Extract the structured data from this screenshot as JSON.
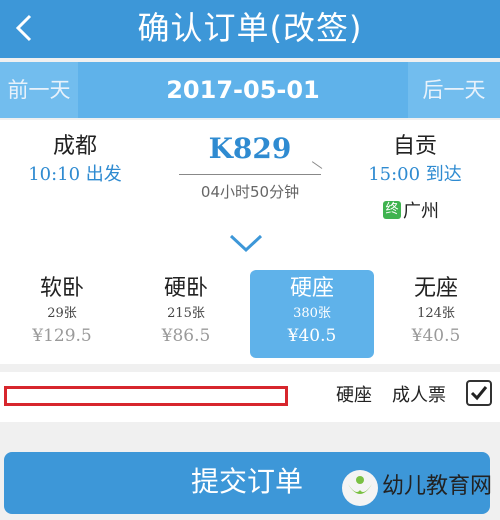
{
  "header": {
    "title": "确认订单(改签)",
    "back_icon": "chevron-left-icon"
  },
  "datebar": {
    "prev": "前一天",
    "date": "2017-05-01",
    "next": "后一天"
  },
  "trip": {
    "from_station": "成都",
    "depart_time": "10:10 出发",
    "train_no": "K829",
    "duration": "04小时50分钟",
    "to_station": "自贡",
    "arrive_time": "15:00 到达",
    "terminal_badge": "终",
    "terminal_station": "广州"
  },
  "seats": [
    {
      "type": "软卧",
      "count": "29张",
      "price": "¥129.5",
      "selected": false
    },
    {
      "type": "硬卧",
      "count": "215张",
      "price": "¥86.5",
      "selected": false
    },
    {
      "type": "硬座",
      "count": "380张",
      "price": "¥40.5",
      "selected": true
    },
    {
      "type": "无座",
      "count": "124张",
      "price": "¥40.5",
      "selected": false
    }
  ],
  "passenger": {
    "seat_type": "硬座",
    "ticket_type": "成人票",
    "checked": true
  },
  "submit_label": "提交订单",
  "watermark": "幼儿教育网",
  "colors": {
    "primary": "#3d97d8",
    "date_bar": "#5fb2ea",
    "accent_text": "#2f8bd1",
    "highlight_box": "#d7262d",
    "terminal_green": "#3fb34f"
  }
}
